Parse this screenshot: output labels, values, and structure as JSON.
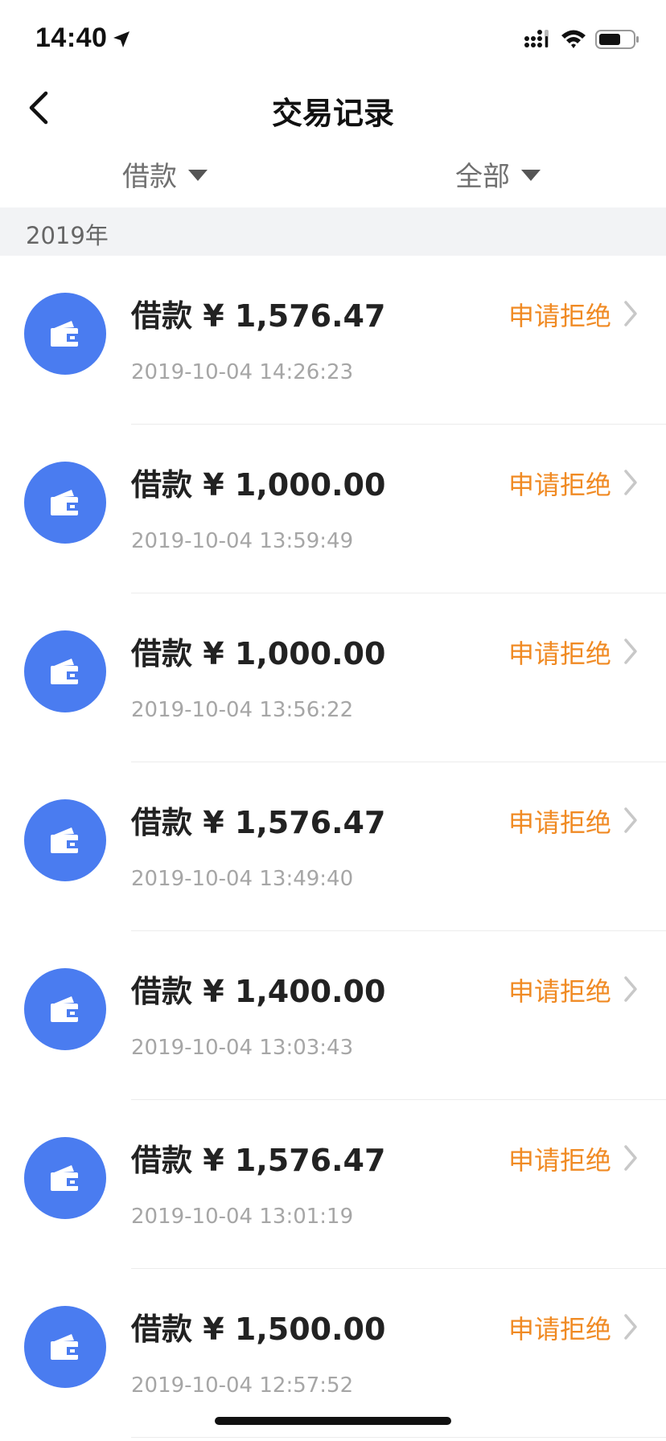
{
  "status_bar": {
    "time": "14:40",
    "icons": [
      "location-arrow-icon",
      "signal-icon",
      "wifi-icon",
      "battery-icon"
    ]
  },
  "nav": {
    "title": "交易记录",
    "back_icon": "chevron-left-icon"
  },
  "filters": {
    "type": "借款",
    "status": "全部"
  },
  "section": {
    "label": "2019年"
  },
  "colors": {
    "accent_blue": "#4a7cf0",
    "status_orange": "#f08a23",
    "section_bg": "#f2f3f5"
  },
  "transactions": [
    {
      "title": "借款 ¥ 1,576.47",
      "time": "2019-10-04 14:26:23",
      "status": "申请拒绝",
      "icon": "wallet-icon"
    },
    {
      "title": "借款 ¥ 1,000.00",
      "time": "2019-10-04 13:59:49",
      "status": "申请拒绝",
      "icon": "wallet-icon"
    },
    {
      "title": "借款 ¥ 1,000.00",
      "time": "2019-10-04 13:56:22",
      "status": "申请拒绝",
      "icon": "wallet-icon"
    },
    {
      "title": "借款 ¥ 1,576.47",
      "time": "2019-10-04 13:49:40",
      "status": "申请拒绝",
      "icon": "wallet-icon"
    },
    {
      "title": "借款 ¥ 1,400.00",
      "time": "2019-10-04 13:03:43",
      "status": "申请拒绝",
      "icon": "wallet-icon"
    },
    {
      "title": "借款 ¥ 1,576.47",
      "time": "2019-10-04 13:01:19",
      "status": "申请拒绝",
      "icon": "wallet-icon"
    },
    {
      "title": "借款 ¥ 1,500.00",
      "time": "2019-10-04 12:57:52",
      "status": "申请拒绝",
      "icon": "wallet-icon"
    }
  ]
}
